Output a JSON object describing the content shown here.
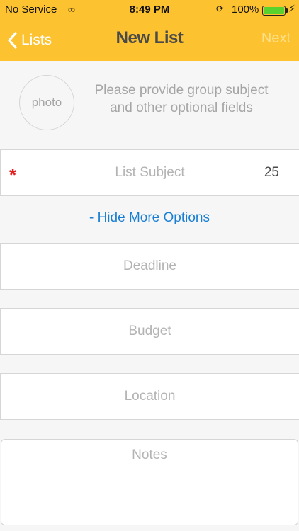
{
  "status_bar": {
    "carrier": "No Service",
    "time": "8:49 PM",
    "battery": "100%"
  },
  "nav": {
    "back_label": "Lists",
    "title": "New List",
    "next_label": "Next"
  },
  "photo": {
    "label": "photo",
    "hint": "Please provide group subject and other optional fields"
  },
  "form": {
    "required_mark": "*",
    "subject_placeholder": "List Subject",
    "subject_counter": "25",
    "toggle_options": "- Hide More Options",
    "deadline_placeholder": "Deadline",
    "budget_placeholder": "Budget",
    "location_placeholder": "Location",
    "notes_placeholder": "Notes"
  },
  "colors": {
    "header": "#fdc230",
    "link": "#1a7fd4",
    "required": "#e02020",
    "battery": "#5ad22e"
  }
}
